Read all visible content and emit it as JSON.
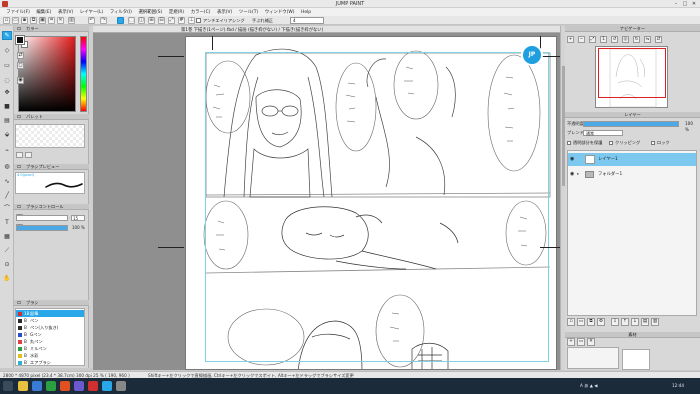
{
  "window": {
    "title": "JUMP PAINT",
    "controls": [
      "–",
      "□",
      "✕"
    ]
  },
  "menu": [
    "ファイル(F)",
    "編集(E)",
    "表示(V)",
    "レイヤー(L)",
    "フィルタ(I)",
    "選択範囲(S)",
    "定規(R)",
    "カラー(C)",
    "表示(V)",
    "ツール(T)",
    "ウィンドウ(W)",
    "Help"
  ],
  "toolbar": {
    "antialias_label": "アンチエイリアシング",
    "correction_label": "手ぶれ補正",
    "correction_value": "4"
  },
  "file_tab": {
    "label": "第1巻 下描き(1ページ).fbd / 描画 (描き枠がない) / 下描き(描き枠がない)"
  },
  "left_panels": {
    "color_title": "カラー",
    "palette_title": "パレット",
    "brush_preview_title": "ブラシプレビュー",
    "brush_preview_value": "4.0(pixel)",
    "brush_control_title": "ブラシコントロール",
    "brush_size": "15",
    "brush_opacity": "100 %",
    "brush_opacity_pct": 100,
    "brush_list_title": "ブラシ",
    "brushes": [
      {
        "key": "1B",
        "name": "鉛筆",
        "color": "#d03030",
        "selected": true
      },
      {
        "key": "B",
        "name": "ペン",
        "color": "#2a2a2a",
        "selected": false
      },
      {
        "key": "B",
        "name": "ペン(入り抜き)",
        "color": "#2a2a2a",
        "selected": false
      },
      {
        "key": "B",
        "name": "Gペン",
        "color": "#2a4ad0",
        "selected": false
      },
      {
        "key": "B",
        "name": "丸ペン",
        "color": "#e04040",
        "selected": false
      },
      {
        "key": "B",
        "name": "ミルペン",
        "color": "#2aa040",
        "selected": false
      },
      {
        "key": "B",
        "name": "水彩",
        "color": "#e0c020",
        "selected": false
      },
      {
        "key": "B",
        "name": "エアブラシ",
        "color": "#30b0d0",
        "selected": false
      }
    ]
  },
  "navigator": {
    "title": "ナビゲーター",
    "icons": [
      "zoom-in",
      "zoom-out",
      "fit",
      "actual",
      "rotate-left",
      "rotate-reset",
      "rotate-right",
      "flip-h",
      "flip-v"
    ]
  },
  "layer_panel": {
    "title": "レイヤー",
    "opacity_label": "不透明度",
    "opacity_value": "100 %",
    "opacity_pct": 100,
    "blend_label": "ブレンド",
    "blend_value": "通常",
    "clip_label": "透明部分を保護",
    "clipping_label": "クリッピング",
    "lock_label": "ロック",
    "layers": [
      {
        "name": "レイヤー1",
        "type": "layer",
        "selected": true
      },
      {
        "name": "フォルダー1",
        "type": "folder",
        "selected": false
      }
    ]
  },
  "materials": {
    "title": "素材"
  },
  "status": {
    "dimensions": "2800 * 4870 pixel  (23.4 * 38.7cm)  300 dpi  25 %  ( 190, 960 )",
    "hint": "Shiftキー+左クリックで直線描画, Ctrlキー+左クリックでスポイト, Altキー+左ドラッグでブラシサイズ変更"
  },
  "taskbar": {
    "clock": "12:44",
    "tray_text": "A あ ▲ ◀"
  },
  "colors": {
    "accent": "#2aa7e8",
    "selection": "#7cc8ee",
    "canvas_bg": "#8f8f8f",
    "trim_guide": "#7fd2e0",
    "nav_frame": "#e02020"
  }
}
